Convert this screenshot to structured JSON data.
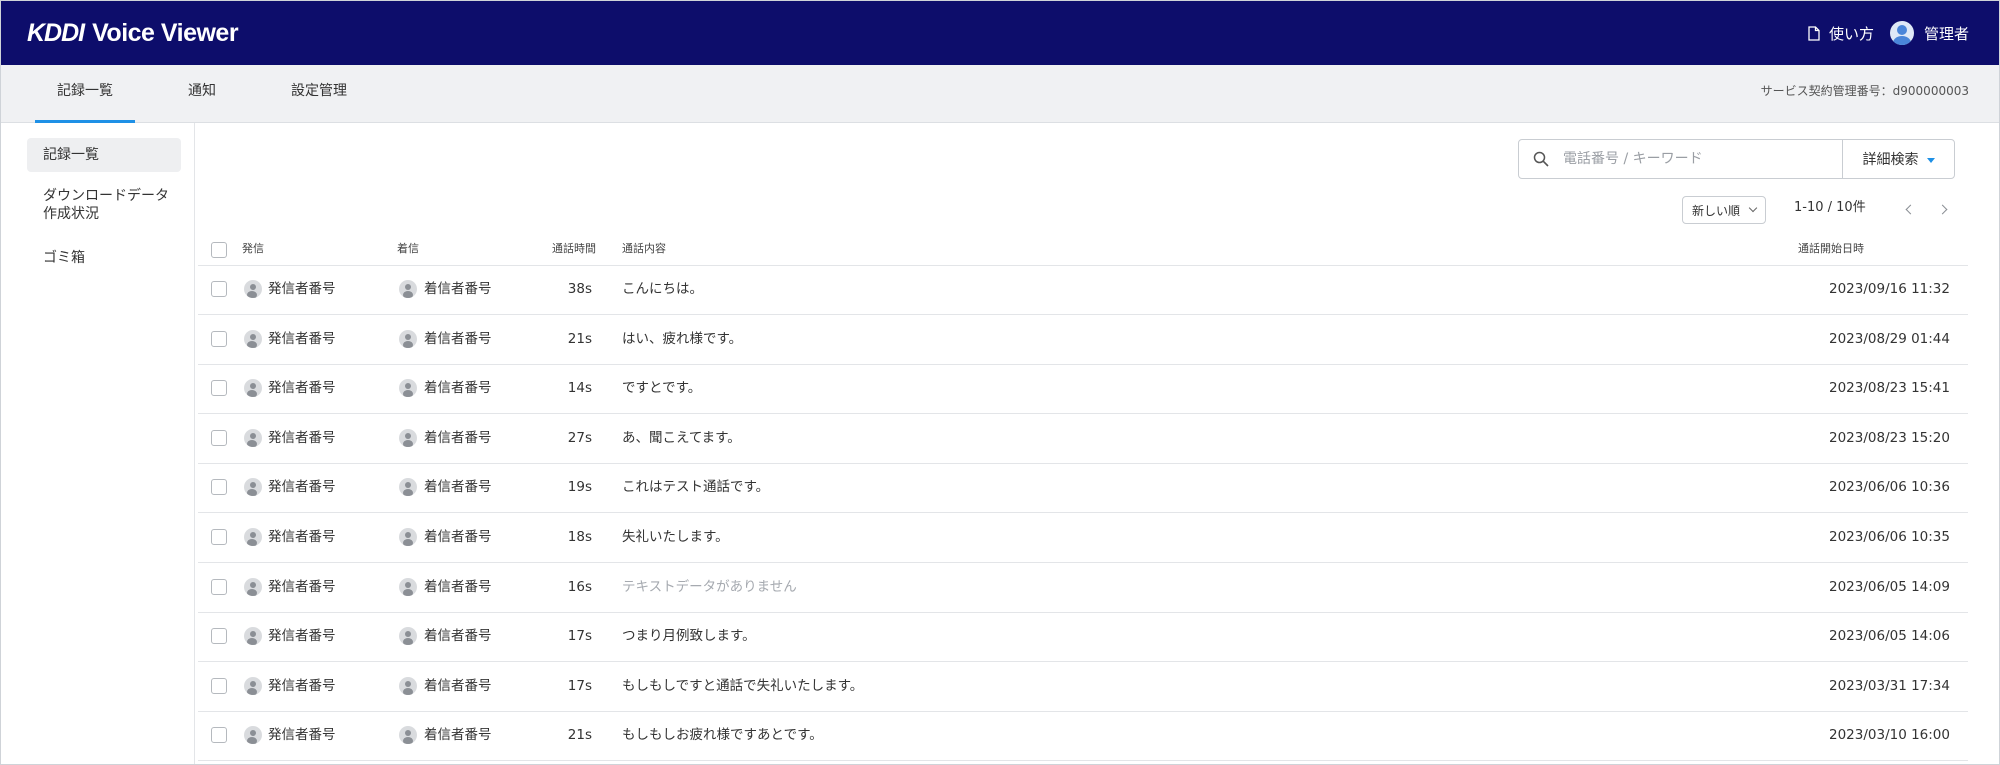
{
  "header": {
    "logo_brand": "KDDI",
    "logo_product": "Voice Viewer",
    "help_label": "使い方",
    "user_label": "管理者",
    "background_color": "#0d0d6b"
  },
  "tabs": [
    {
      "label": "記録一覧",
      "active": true
    },
    {
      "label": "通知",
      "active": false
    },
    {
      "label": "設定管理",
      "active": false
    }
  ],
  "contract_label": "サービス契約管理番号：d900000003",
  "sidebar": {
    "items": [
      {
        "label": "記録一覧",
        "active": true
      },
      {
        "label_line1": "ダウンロードデータ",
        "label_line2": "作成状況",
        "active": false
      },
      {
        "label": "ゴミ箱",
        "active": false
      }
    ]
  },
  "search": {
    "placeholder": "電話番号 / キーワード",
    "value": "",
    "advanced_label": "詳細検索"
  },
  "sort": {
    "selected": "新しい順"
  },
  "pagination": {
    "label": "1-10 / 10件"
  },
  "table": {
    "headers": {
      "caller": "発信",
      "callee": "着信",
      "duration": "通話時間",
      "content": "通話内容",
      "start": "通話開始日時"
    },
    "rows": [
      {
        "caller": "発信者番号",
        "callee": "着信者番号",
        "duration": "38s",
        "content": "こんにちは。",
        "start": "2023/09/16 11:32"
      },
      {
        "caller": "発信者番号",
        "callee": "着信者番号",
        "duration": "21s",
        "content": "はい、疲れ様です。",
        "start": "2023/08/29 01:44"
      },
      {
        "caller": "発信者番号",
        "callee": "着信者番号",
        "duration": "14s",
        "content": "ですとです。",
        "start": "2023/08/23 15:41"
      },
      {
        "caller": "発信者番号",
        "callee": "着信者番号",
        "duration": "27s",
        "content": "あ、聞こえてます。",
        "start": "2023/08/23 15:20"
      },
      {
        "caller": "発信者番号",
        "callee": "着信者番号",
        "duration": "19s",
        "content": "これはテスト通話です。",
        "start": "2023/06/06 10:36"
      },
      {
        "caller": "発信者番号",
        "callee": "着信者番号",
        "duration": "18s",
        "content": "失礼いたします。",
        "start": "2023/06/06 10:35"
      },
      {
        "caller": "発信者番号",
        "callee": "着信者番号",
        "duration": "16s",
        "content": "テキストデータがありません",
        "start": "2023/06/05 14:09",
        "muted": true
      },
      {
        "caller": "発信者番号",
        "callee": "着信者番号",
        "duration": "17s",
        "content": "つまり月例致します。",
        "start": "2023/06/05 14:06"
      },
      {
        "caller": "発信者番号",
        "callee": "着信者番号",
        "duration": "17s",
        "content": "もしもしですと通話で失礼いたします。",
        "start": "2023/03/31 17:34"
      },
      {
        "caller": "発信者番号",
        "callee": "着信者番号",
        "duration": "21s",
        "content": "もしもしお疲れ様ですあとです。",
        "start": "2023/03/10 16:00"
      }
    ]
  }
}
